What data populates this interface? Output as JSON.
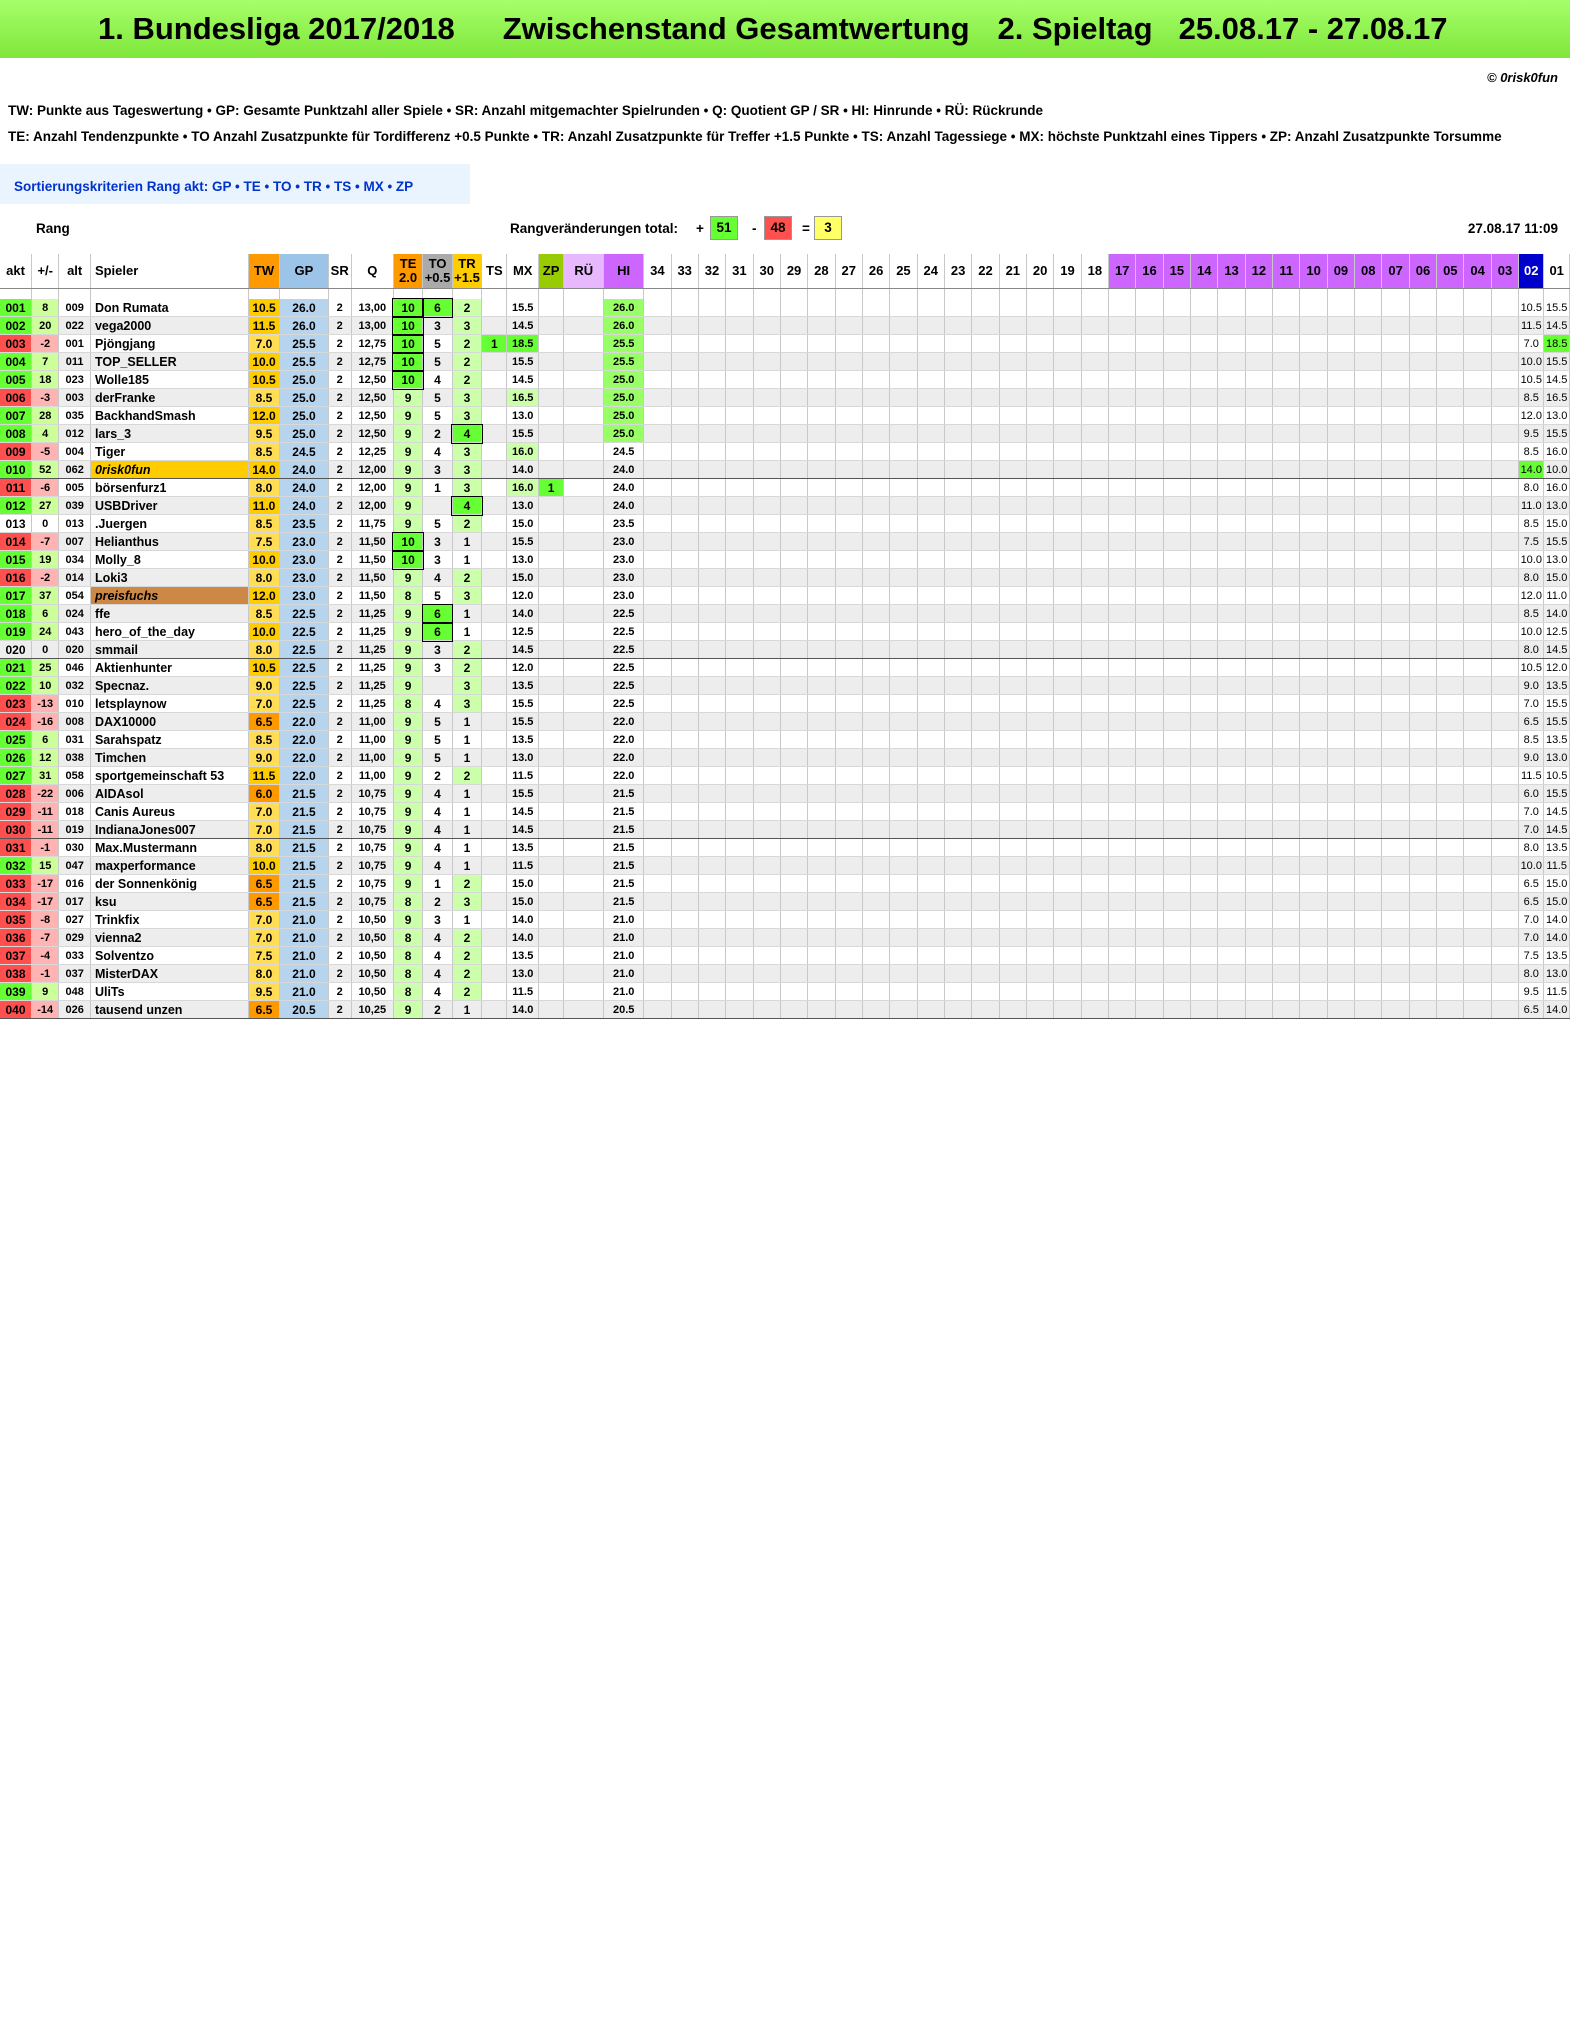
{
  "title": {
    "league": "1. Bundesliga 2017/2018",
    "section": "Zwischenstand Gesamtwertung",
    "matchday": "2. Spieltag",
    "dates": "25.08.17 - 27.08.17"
  },
  "copyright": "© 0risk0fun",
  "legend1": "TW: Punkte aus Tageswertung  •  GP: Gesamte Punktzahl aller Spiele  •  SR: Anzahl mitgemachter Spielrunden  •  Q: Quotient GP / SR  •  HI: Hinrunde  •  RÜ: Rückrunde",
  "legend2": "TE: Anzahl Tendenzpunkte  •  TO Anzahl Zusatzpunkte für Tordifferenz +0.5 Punkte  •  TR: Anzahl Zusatzpunkte für Treffer +1.5 Punkte  •  TS: Anzahl Tagessiege  •  MX: höchste Punktzahl eines Tippers  •  ZP: Anzahl Zusatzpunkte Torsumme",
  "sort_label": "Sortierungskriterien Rang akt:  GP  •  TE  •  TO  •  TR  •  TS  •  MX  •  ZP",
  "rang_label": "Rang",
  "rangchanges": {
    "label": "Rangveränderungen total:",
    "plus_sign": "+",
    "plus": "51",
    "minus_sign": "-",
    "minus": "48",
    "eq_sign": "=",
    "eq": "3"
  },
  "stamp": "27.08.17   11:09",
  "colors": {
    "title_green": "#7fe63a",
    "tw_orange": "#ff9900",
    "gp_blue": "#9cc4e8",
    "hi_violet": "#cc66ff",
    "rue_violet": "#e8b8ff",
    "md02_blue": "#0000cc",
    "pos_green": "#66ff33",
    "neg_red": "#ff5050",
    "eq_yellow": "#ffff66"
  },
  "columns": [
    "akt",
    "+/-",
    "alt",
    "Spieler",
    "TW",
    "GP",
    "SR",
    "Q",
    "TE 2.0",
    "TO +0.5",
    "TR +1.5",
    "TS",
    "MX",
    "ZP",
    "RÜ",
    "HI",
    "34",
    "33",
    "32",
    "31",
    "30",
    "29",
    "28",
    "27",
    "26",
    "25",
    "24",
    "23",
    "22",
    "21",
    "20",
    "19",
    "18",
    "17",
    "16",
    "15",
    "14",
    "13",
    "12",
    "11",
    "10",
    "09",
    "08",
    "07",
    "06",
    "05",
    "04",
    "03",
    "02",
    "01"
  ],
  "rows": [
    [
      "001",
      "8",
      "009",
      "Don Rumata",
      "10.5",
      "26.0",
      "2",
      "13,00",
      "10",
      "6",
      "2",
      "",
      "15.5",
      "",
      "",
      "26.0",
      "10.5",
      "15.5"
    ],
    [
      "002",
      "20",
      "022",
      "vega2000",
      "11.5",
      "26.0",
      "2",
      "13,00",
      "10",
      "3",
      "3",
      "",
      "14.5",
      "",
      "",
      "26.0",
      "11.5",
      "14.5"
    ],
    [
      "003",
      "-2",
      "001",
      "Pjöngjang",
      "7.0",
      "25.5",
      "2",
      "12,75",
      "10",
      "5",
      "2",
      "1",
      "18.5",
      "",
      "",
      "25.5",
      "7.0",
      "18.5"
    ],
    [
      "004",
      "7",
      "011",
      "TOP_SELLER",
      "10.0",
      "25.5",
      "2",
      "12,75",
      "10",
      "5",
      "2",
      "",
      "15.5",
      "",
      "",
      "25.5",
      "10.0",
      "15.5"
    ],
    [
      "005",
      "18",
      "023",
      "Wolle185",
      "10.5",
      "25.0",
      "2",
      "12,50",
      "10",
      "4",
      "2",
      "",
      "14.5",
      "",
      "",
      "25.0",
      "10.5",
      "14.5"
    ],
    [
      "006",
      "-3",
      "003",
      "derFranke",
      "8.5",
      "25.0",
      "2",
      "12,50",
      "9",
      "5",
      "3",
      "",
      "16.5",
      "",
      "",
      "25.0",
      "8.5",
      "16.5"
    ],
    [
      "007",
      "28",
      "035",
      "BackhandSmash",
      "12.0",
      "25.0",
      "2",
      "12,50",
      "9",
      "5",
      "3",
      "",
      "13.0",
      "",
      "",
      "25.0",
      "12.0",
      "13.0"
    ],
    [
      "008",
      "4",
      "012",
      "lars_3",
      "9.5",
      "25.0",
      "2",
      "12,50",
      "9",
      "2",
      "4",
      "",
      "15.5",
      "",
      "",
      "25.0",
      "9.5",
      "15.5"
    ],
    [
      "009",
      "-5",
      "004",
      "Tiger",
      "8.5",
      "24.5",
      "2",
      "12,25",
      "9",
      "4",
      "3",
      "",
      "16.0",
      "",
      "",
      "24.5",
      "8.5",
      "16.0"
    ],
    [
      "010",
      "52",
      "062",
      "0risk0fun",
      "14.0",
      "24.0",
      "2",
      "12,00",
      "9",
      "3",
      "3",
      "",
      "14.0",
      "",
      "",
      "24.0",
      "14.0",
      "10.0"
    ],
    [
      "011",
      "-6",
      "005",
      "börsenfurz1",
      "8.0",
      "24.0",
      "2",
      "12,00",
      "9",
      "1",
      "3",
      "",
      "16.0",
      "1",
      "",
      "24.0",
      "8.0",
      "16.0"
    ],
    [
      "012",
      "27",
      "039",
      "USBDriver",
      "11.0",
      "24.0",
      "2",
      "12,00",
      "9",
      "",
      "4",
      "",
      "13.0",
      "",
      "",
      "24.0",
      "11.0",
      "13.0"
    ],
    [
      "013",
      "0",
      "013",
      ".Juergen",
      "8.5",
      "23.5",
      "2",
      "11,75",
      "9",
      "5",
      "2",
      "",
      "15.0",
      "",
      "",
      "23.5",
      "8.5",
      "15.0"
    ],
    [
      "014",
      "-7",
      "007",
      "Helianthus",
      "7.5",
      "23.0",
      "2",
      "11,50",
      "10",
      "3",
      "1",
      "",
      "15.5",
      "",
      "",
      "23.0",
      "7.5",
      "15.5"
    ],
    [
      "015",
      "19",
      "034",
      "Molly_8",
      "10.0",
      "23.0",
      "2",
      "11,50",
      "10",
      "3",
      "1",
      "",
      "13.0",
      "",
      "",
      "23.0",
      "10.0",
      "13.0"
    ],
    [
      "016",
      "-2",
      "014",
      "Loki3",
      "8.0",
      "23.0",
      "2",
      "11,50",
      "9",
      "4",
      "2",
      "",
      "15.0",
      "",
      "",
      "23.0",
      "8.0",
      "15.0"
    ],
    [
      "017",
      "37",
      "054",
      "preisfuchs",
      "12.0",
      "23.0",
      "2",
      "11,50",
      "8",
      "5",
      "3",
      "",
      "12.0",
      "",
      "",
      "23.0",
      "12.0",
      "11.0"
    ],
    [
      "018",
      "6",
      "024",
      "ffe",
      "8.5",
      "22.5",
      "2",
      "11,25",
      "9",
      "6",
      "1",
      "",
      "14.0",
      "",
      "",
      "22.5",
      "8.5",
      "14.0"
    ],
    [
      "019",
      "24",
      "043",
      "hero_of_the_day",
      "10.0",
      "22.5",
      "2",
      "11,25",
      "9",
      "6",
      "1",
      "",
      "12.5",
      "",
      "",
      "22.5",
      "10.0",
      "12.5"
    ],
    [
      "020",
      "0",
      "020",
      "smmail",
      "8.0",
      "22.5",
      "2",
      "11,25",
      "9",
      "3",
      "2",
      "",
      "14.5",
      "",
      "",
      "22.5",
      "8.0",
      "14.5"
    ],
    [
      "021",
      "25",
      "046",
      "Aktienhunter",
      "10.5",
      "22.5",
      "2",
      "11,25",
      "9",
      "3",
      "2",
      "",
      "12.0",
      "",
      "",
      "22.5",
      "10.5",
      "12.0"
    ],
    [
      "022",
      "10",
      "032",
      "Specnaz.",
      "9.0",
      "22.5",
      "2",
      "11,25",
      "9",
      "",
      "3",
      "",
      "13.5",
      "",
      "",
      "22.5",
      "9.0",
      "13.5"
    ],
    [
      "023",
      "-13",
      "010",
      "letsplaynow",
      "7.0",
      "22.5",
      "2",
      "11,25",
      "8",
      "4",
      "3",
      "",
      "15.5",
      "",
      "",
      "22.5",
      "7.0",
      "15.5"
    ],
    [
      "024",
      "-16",
      "008",
      "DAX10000",
      "6.5",
      "22.0",
      "2",
      "11,00",
      "9",
      "5",
      "1",
      "",
      "15.5",
      "",
      "",
      "22.0",
      "6.5",
      "15.5"
    ],
    [
      "025",
      "6",
      "031",
      "Sarahspatz",
      "8.5",
      "22.0",
      "2",
      "11,00",
      "9",
      "5",
      "1",
      "",
      "13.5",
      "",
      "",
      "22.0",
      "8.5",
      "13.5"
    ],
    [
      "026",
      "12",
      "038",
      "Timchen",
      "9.0",
      "22.0",
      "2",
      "11,00",
      "9",
      "5",
      "1",
      "",
      "13.0",
      "",
      "",
      "22.0",
      "9.0",
      "13.0"
    ],
    [
      "027",
      "31",
      "058",
      "sportgemeinschaft 53",
      "11.5",
      "22.0",
      "2",
      "11,00",
      "9",
      "2",
      "2",
      "",
      "11.5",
      "",
      "",
      "22.0",
      "11.5",
      "10.5"
    ],
    [
      "028",
      "-22",
      "006",
      "AIDAsol",
      "6.0",
      "21.5",
      "2",
      "10,75",
      "9",
      "4",
      "1",
      "",
      "15.5",
      "",
      "",
      "21.5",
      "6.0",
      "15.5"
    ],
    [
      "029",
      "-11",
      "018",
      "Canis Aureus",
      "7.0",
      "21.5",
      "2",
      "10,75",
      "9",
      "4",
      "1",
      "",
      "14.5",
      "",
      "",
      "21.5",
      "7.0",
      "14.5"
    ],
    [
      "030",
      "-11",
      "019",
      "IndianaJones007",
      "7.0",
      "21.5",
      "2",
      "10,75",
      "9",
      "4",
      "1",
      "",
      "14.5",
      "",
      "",
      "21.5",
      "7.0",
      "14.5"
    ],
    [
      "031",
      "-1",
      "030",
      "Max.Mustermann",
      "8.0",
      "21.5",
      "2",
      "10,75",
      "9",
      "4",
      "1",
      "",
      "13.5",
      "",
      "",
      "21.5",
      "8.0",
      "13.5"
    ],
    [
      "032",
      "15",
      "047",
      "maxperformance",
      "10.0",
      "21.5",
      "2",
      "10,75",
      "9",
      "4",
      "1",
      "",
      "11.5",
      "",
      "",
      "21.5",
      "10.0",
      "11.5"
    ],
    [
      "033",
      "-17",
      "016",
      "der Sonnenkönig",
      "6.5",
      "21.5",
      "2",
      "10,75",
      "9",
      "1",
      "2",
      "",
      "15.0",
      "",
      "",
      "21.5",
      "6.5",
      "15.0"
    ],
    [
      "034",
      "-17",
      "017",
      "ksu",
      "6.5",
      "21.5",
      "2",
      "10,75",
      "8",
      "2",
      "3",
      "",
      "15.0",
      "",
      "",
      "21.5",
      "6.5",
      "15.0"
    ],
    [
      "035",
      "-8",
      "027",
      "Trinkfix",
      "7.0",
      "21.0",
      "2",
      "10,50",
      "9",
      "3",
      "1",
      "",
      "14.0",
      "",
      "",
      "21.0",
      "7.0",
      "14.0"
    ],
    [
      "036",
      "-7",
      "029",
      "vienna2",
      "7.0",
      "21.0",
      "2",
      "10,50",
      "8",
      "4",
      "2",
      "",
      "14.0",
      "",
      "",
      "21.0",
      "7.0",
      "14.0"
    ],
    [
      "037",
      "-4",
      "033",
      "Solventzo",
      "7.5",
      "21.0",
      "2",
      "10,50",
      "8",
      "4",
      "2",
      "",
      "13.5",
      "",
      "",
      "21.0",
      "7.5",
      "13.5"
    ],
    [
      "038",
      "-1",
      "037",
      "MisterDAX",
      "8.0",
      "21.0",
      "2",
      "10,50",
      "8",
      "4",
      "2",
      "",
      "13.0",
      "",
      "",
      "21.0",
      "8.0",
      "13.0"
    ],
    [
      "039",
      "9",
      "048",
      "UliTs",
      "9.5",
      "21.0",
      "2",
      "10,50",
      "8",
      "4",
      "2",
      "",
      "11.5",
      "",
      "",
      "21.0",
      "9.5",
      "11.5"
    ],
    [
      "040",
      "-14",
      "026",
      "tausend unzen",
      "6.5",
      "20.5",
      "2",
      "10,25",
      "9",
      "2",
      "1",
      "",
      "14.0",
      "",
      "",
      "20.5",
      "6.5",
      "14.0"
    ]
  ]
}
